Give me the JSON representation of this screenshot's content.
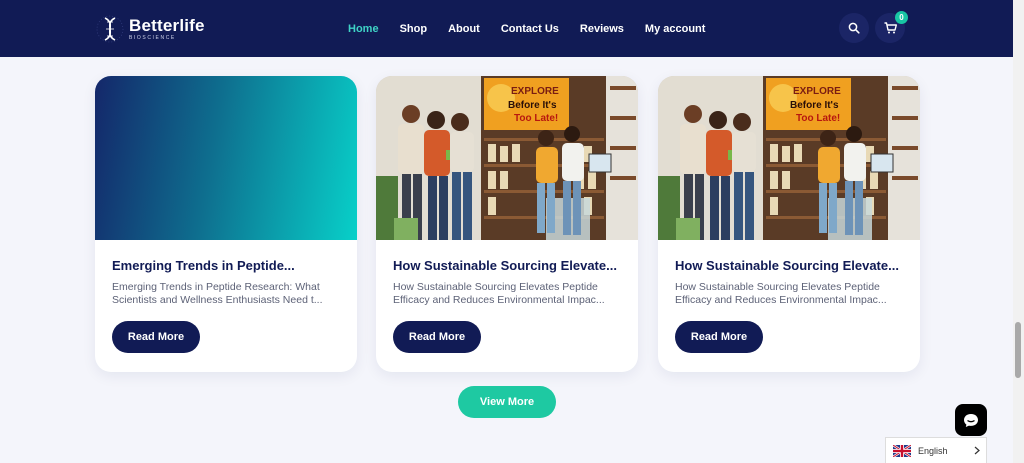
{
  "brand": {
    "name": "Betterlife",
    "sub": "BIOSCIENCE"
  },
  "nav": {
    "items": [
      {
        "label": "Home",
        "active": true
      },
      {
        "label": "Shop"
      },
      {
        "label": "About"
      },
      {
        "label": "Contact Us"
      },
      {
        "label": "Reviews"
      },
      {
        "label": "My account"
      }
    ]
  },
  "header": {
    "search_icon": "search-icon",
    "cart_icon": "cart-icon",
    "cart_count": "0"
  },
  "cards": [
    {
      "title": "Emerging Trends in Peptide...",
      "excerpt_line1": "Emerging Trends in Peptide Research: What",
      "excerpt_line2": "Scientists and Wellness Enthusiasts Need t...",
      "button": "Read More"
    },
    {
      "title": "How Sustainable Sourcing Elevate...",
      "excerpt_line1": "How Sustainable Sourcing Elevates Peptide",
      "excerpt_line2": "Efficacy and Reduces Environmental Impac...",
      "button": "Read More",
      "sign_line1": "EXPLORE",
      "sign_line2": "Before It's",
      "sign_line3": "Too Late!"
    },
    {
      "title": "How Sustainable Sourcing Elevate...",
      "excerpt_line1": "How Sustainable Sourcing Elevates Peptide",
      "excerpt_line2": "Efficacy and Reduces Environmental Impac...",
      "button": "Read More",
      "sign_line1": "EXPLORE",
      "sign_line2": "Before It's",
      "sign_line3": "Too Late!"
    }
  ],
  "view_more": "View More",
  "language": {
    "label": "English"
  },
  "colors": {
    "navy": "#111b55",
    "teal": "#1ec9a2",
    "active_nav": "#3fd3c6"
  }
}
